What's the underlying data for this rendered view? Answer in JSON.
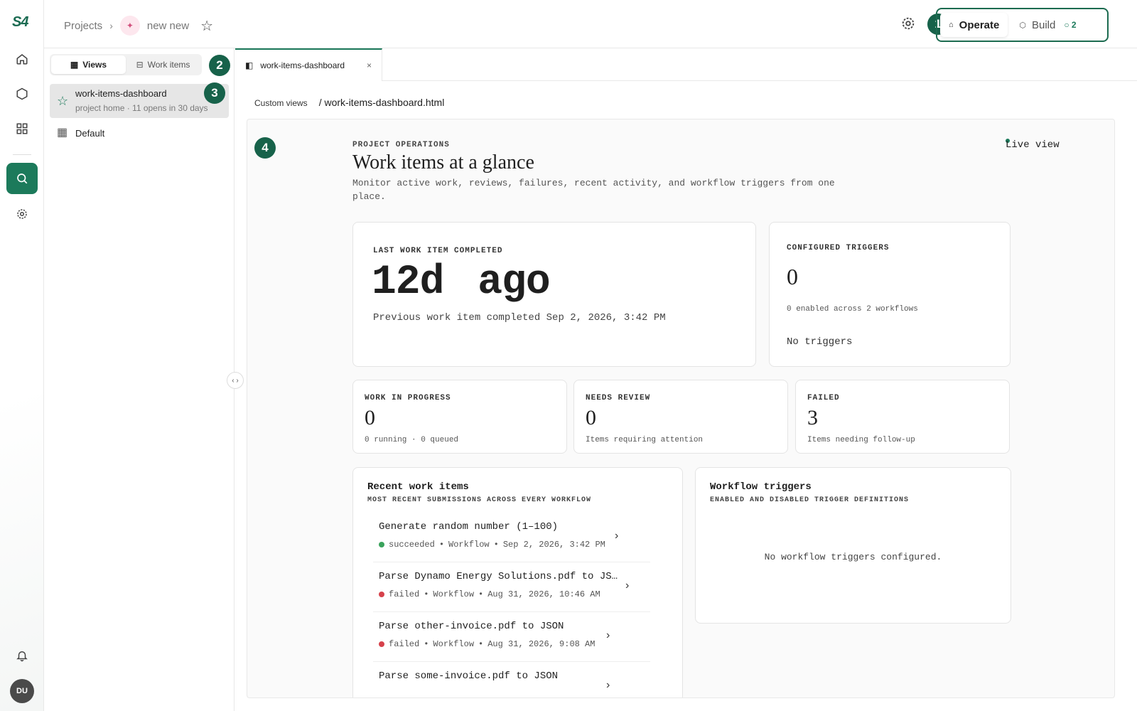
{
  "rail": {
    "logo": "S4",
    "avatar": "DU"
  },
  "breadcrumb": {
    "projects": "Projects",
    "project_name": "new new"
  },
  "modes": {
    "operate": "Operate",
    "build": "Build",
    "build_badge": "2"
  },
  "markers": [
    "1",
    "2",
    "3",
    "4"
  ],
  "sidebar": {
    "tabs": {
      "views": "Views",
      "work_items": "Work items"
    },
    "items": [
      {
        "label": "work-items-dashboard",
        "sub": "project home · 11 opens in 30 days"
      },
      {
        "label": "Default"
      }
    ],
    "collapse": "‹ ›"
  },
  "tab": {
    "label": "work-items-dashboard",
    "close": "×"
  },
  "path": {
    "root": "Custom views",
    "file": "/ work-items-dashboard.html"
  },
  "dashboard": {
    "eyebrow": "PROJECT OPERATIONS",
    "title": "Work items at a glance",
    "description": "Monitor active work, reviews, failures, recent activity, and workflow triggers from one place.",
    "live": "Live view",
    "last": {
      "label": "LAST WORK ITEM COMPLETED",
      "value": "12d ago",
      "sub": "Previous work item completed Sep 2, 2026, 3:42 PM"
    },
    "triggers": {
      "label": "CONFIGURED TRIGGERS",
      "value": "0",
      "sub": "0 enabled across 2 workflows",
      "none": "No triggers"
    },
    "stats": [
      {
        "label": "WORK IN PROGRESS",
        "value": "0",
        "sub": "0 running · 0 queued"
      },
      {
        "label": "NEEDS REVIEW",
        "value": "0",
        "sub": "Items requiring attention"
      },
      {
        "label": "FAILED",
        "value": "3",
        "sub": "Items needing follow-up"
      }
    ],
    "recent": {
      "title": "Recent work items",
      "subtitle": "MOST RECENT SUBMISSIONS ACROSS EVERY WORKFLOW",
      "items": [
        {
          "name": "Generate random number (1–100)",
          "status": "succeeded",
          "type": "Workflow",
          "time": "Sep 2, 2026, 3:42 PM"
        },
        {
          "name": "Parse Dynamo Energy Solutions.pdf to JS…",
          "status": "failed",
          "type": "Workflow",
          "time": "Aug 31, 2026, 10:46 AM"
        },
        {
          "name": "Parse other-invoice.pdf to JSON",
          "status": "failed",
          "type": "Workflow",
          "time": "Aug 31, 2026, 9:08 AM"
        },
        {
          "name": "Parse some-invoice.pdf to JSON",
          "status": "",
          "type": "",
          "time": ""
        }
      ]
    },
    "workflow": {
      "title": "Workflow triggers",
      "subtitle": "ENABLED AND DISABLED TRIGGER DEFINITIONS",
      "empty": "No workflow triggers configured."
    }
  },
  "colors": {
    "accent": "#1c7a5b",
    "success": "#3aa35c",
    "failed": "#d6424b"
  }
}
